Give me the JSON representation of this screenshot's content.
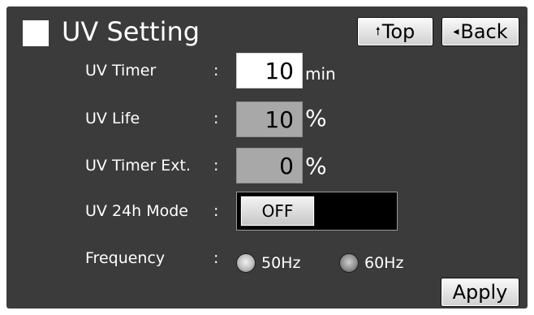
{
  "header": {
    "title": "UV Setting",
    "top_label": "Top",
    "top_icon": "up-arrow-icon",
    "back_label": "Back",
    "back_icon": "left-triangle-icon"
  },
  "rows": {
    "uv_timer": {
      "label": "UV Timer",
      "colon": ":",
      "value": "10",
      "unit": "min"
    },
    "uv_life": {
      "label": "UV Life",
      "colon": ":",
      "value": "10",
      "unit": "%"
    },
    "uv_timer_ext": {
      "label": "UV Timer Ext.",
      "colon": ":",
      "value": "0",
      "unit": "%"
    },
    "uv_24h_mode": {
      "label": "UV 24h Mode",
      "colon": ":",
      "state": "OFF"
    },
    "frequency": {
      "label": "Frequency",
      "colon": ":",
      "options": [
        "50Hz",
        "60Hz"
      ],
      "selected": "50Hz"
    }
  },
  "apply_label": "Apply",
  "colors": {
    "panel_background": "#3b3b3b",
    "text": "#ffffff",
    "button_face": "#e6e6e6",
    "readonly_field": "#a8a8a8"
  }
}
